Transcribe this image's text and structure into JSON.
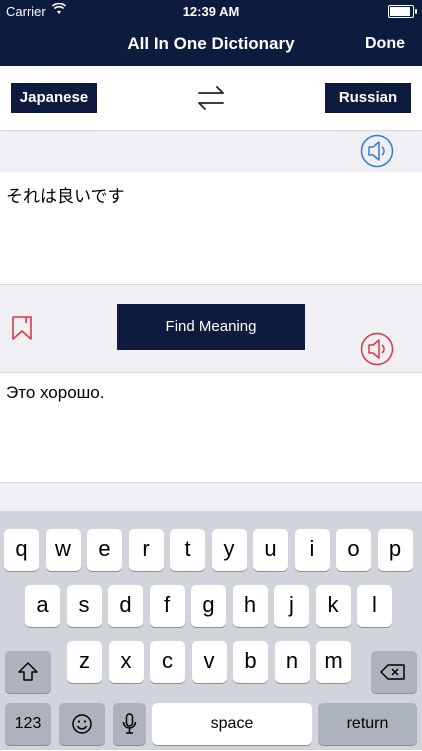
{
  "status_bar": {
    "carrier": "Carrier",
    "time": "12:39 AM"
  },
  "nav": {
    "title": "All In One Dictionary",
    "done_label": "Done"
  },
  "languages": {
    "source": "Japanese",
    "target": "Russian"
  },
  "input_text": "それは良いです",
  "find_label": "Find Meaning",
  "output_text": "Это хорошо.",
  "colors": {
    "navy": "#0d1b3e",
    "speaker_blue": "#3a7bd5",
    "speaker_red": "#e0364a"
  },
  "keyboard": {
    "row1": [
      "q",
      "w",
      "e",
      "r",
      "t",
      "y",
      "u",
      "i",
      "o",
      "p"
    ],
    "row2": [
      "a",
      "s",
      "d",
      "f",
      "g",
      "h",
      "j",
      "k",
      "l"
    ],
    "row3": [
      "z",
      "x",
      "c",
      "v",
      "b",
      "n",
      "m"
    ],
    "numbers_label": "123",
    "space_label": "space",
    "return_label": "return"
  }
}
